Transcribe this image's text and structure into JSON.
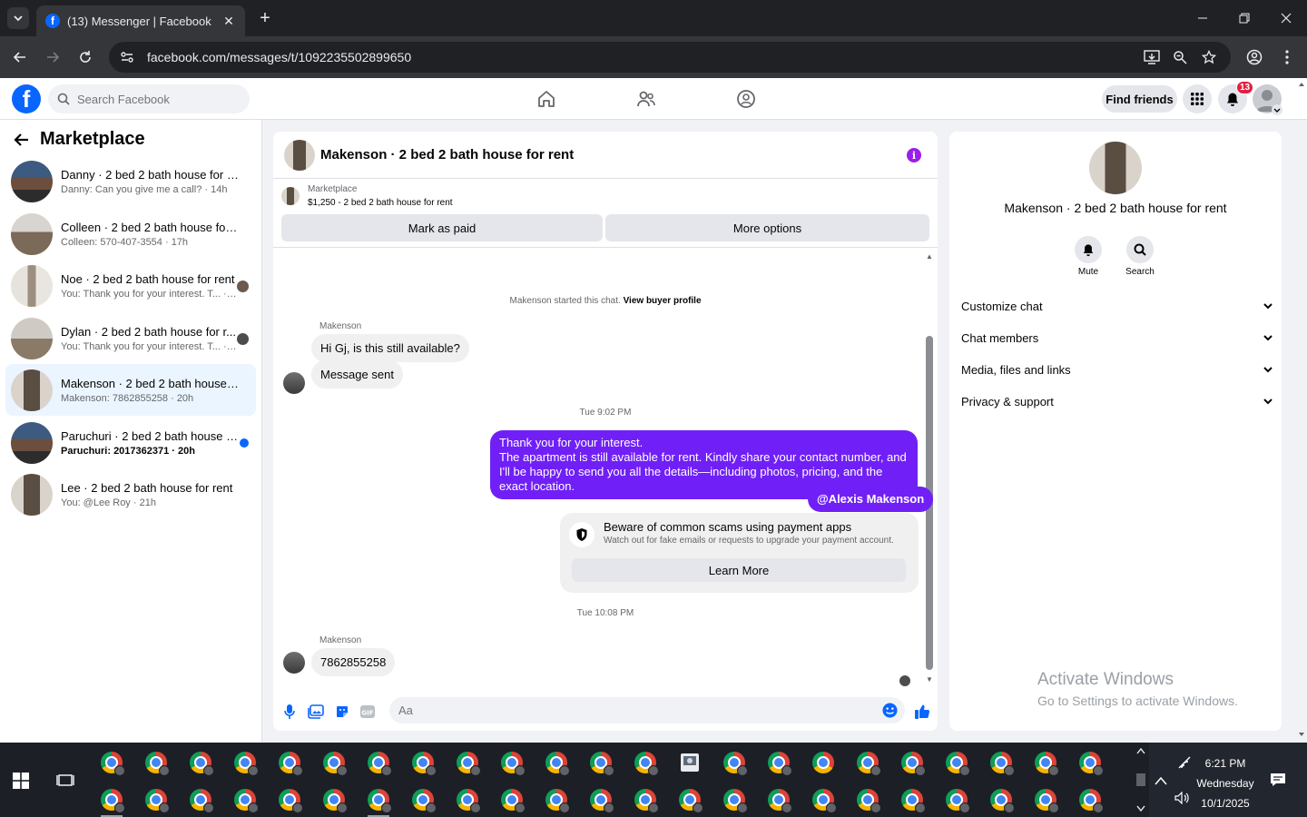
{
  "browser": {
    "tab_title": "(13) Messenger | Facebook",
    "url": "facebook.com/messages/t/1092235502899650"
  },
  "fb": {
    "search_placeholder": "Search Facebook",
    "find_friends": "Find friends",
    "notification_count": "13"
  },
  "left": {
    "title": "Marketplace",
    "conversations": [
      {
        "name": "Danny · 2 bed 2 bath house for rent",
        "snippet": "Danny: Can you give me a call? · 14h",
        "unread": false,
        "active": false
      },
      {
        "name": "Colleen · 2 bed 2 bath house for re...",
        "snippet": "Colleen: 570-407-3554 · 17h",
        "unread": false,
        "active": false
      },
      {
        "name": "Noe · 2 bed 2 bath house for rent",
        "snippet": "You: Thank you for your interest. T... · 17h",
        "unread": false,
        "active": false
      },
      {
        "name": "Dylan · 2 bed 2 bath house for r...",
        "snippet": "You: Thank you for your interest. T... · 19h",
        "unread": false,
        "active": false
      },
      {
        "name": "Makenson · 2 bed 2 bath house fo...",
        "snippet": "Makenson: 7862855258 · 20h",
        "unread": false,
        "active": true
      },
      {
        "name": "Paruchuri · 2 bed 2 bath house f...",
        "snippet": "Paruchuri: 2017362371 · 20h",
        "unread": true,
        "active": false
      },
      {
        "name": "Lee · 2 bed 2 bath house for rent",
        "snippet": "You: @Lee Roy · 21h",
        "unread": false,
        "active": false
      }
    ]
  },
  "chat": {
    "title": "Makenson · 2 bed 2 bath house for rent",
    "marketplace_label": "Marketplace",
    "listing": "$1,250 - 2 bed 2 bath house for rent",
    "mark_paid": "Mark as paid",
    "more_options": "More options",
    "started_text": "Makenson started this chat.",
    "view_buyer": "View buyer profile",
    "sender_1": "Makenson",
    "msg_1": "Hi Gj, is this still available?",
    "msg_2": "Message sent",
    "ts_1": "Tue 9:02 PM",
    "out_1_line1": "Thank you for your interest.",
    "out_1_line2": "The apartment is still available for rent. Kindly share your contact number, and I'll be happy to send you all the details—including photos, pricing, and the exact location.",
    "out_2": "@Alexis Makenson",
    "scam_title": "Beware of common scams using payment apps",
    "scam_sub": "Watch out for fake emails or requests to upgrade your payment account.",
    "learn_more": "Learn More",
    "ts_2": "Tue 10:08 PM",
    "sender_2": "Makenson",
    "msg_3": "7862855258",
    "composer_placeholder": "Aa"
  },
  "right": {
    "title": "Makenson · 2 bed 2 bath house for rent",
    "mute": "Mute",
    "search": "Search",
    "sections": [
      "Customize chat",
      "Chat members",
      "Media, files and links",
      "Privacy & support"
    ]
  },
  "watermark": {
    "line1": "Activate Windows",
    "line2": "Go to Settings to activate Windows."
  },
  "taskbar": {
    "time": "6:21 PM",
    "day": "Wednesday",
    "date": "10/1/2025"
  }
}
